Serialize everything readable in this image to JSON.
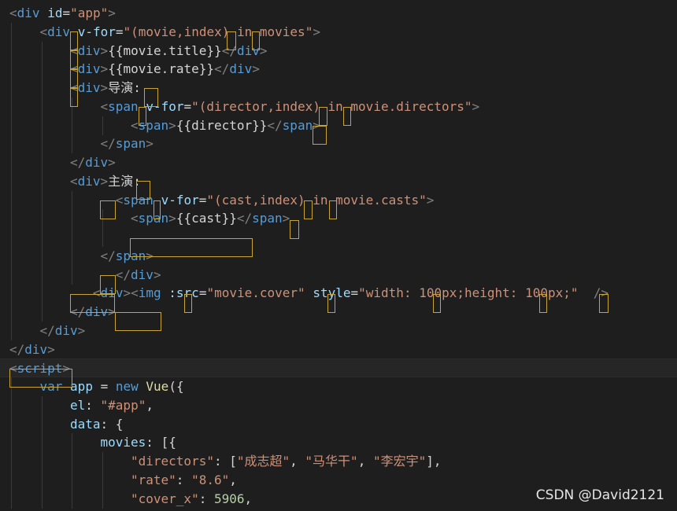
{
  "code_lines": [
    {
      "indent": 0,
      "tokens": [
        [
          "punct",
          "<"
        ],
        [
          "tag",
          "div"
        ],
        [
          "txt",
          " "
        ],
        [
          "attr",
          "id"
        ],
        [
          "txt",
          "="
        ],
        [
          "str",
          "\"app\""
        ],
        [
          "punct",
          ">"
        ]
      ]
    },
    {
      "indent": 1,
      "tokens": [
        [
          "punct",
          "<"
        ],
        [
          "tag",
          "div"
        ],
        [
          "txt",
          " "
        ],
        [
          "attr",
          "v-for"
        ],
        [
          "txt",
          "="
        ],
        [
          "str",
          "\"(movie,index) in movies\""
        ],
        [
          "punct",
          ">"
        ]
      ]
    },
    {
      "indent": 2,
      "tokens": [
        [
          "punct",
          "<"
        ],
        [
          "tag",
          "div"
        ],
        [
          "punct",
          ">"
        ],
        [
          "txt",
          "{{movie.title}}"
        ],
        [
          "punct",
          "</"
        ],
        [
          "tag",
          "div"
        ],
        [
          "punct",
          ">"
        ]
      ]
    },
    {
      "indent": 2,
      "tokens": [
        [
          "punct",
          "<"
        ],
        [
          "tag",
          "div"
        ],
        [
          "punct",
          ">"
        ],
        [
          "txt",
          "{{movie.rate}}"
        ],
        [
          "punct",
          "</"
        ],
        [
          "tag",
          "div"
        ],
        [
          "punct",
          ">"
        ]
      ]
    },
    {
      "indent": 2,
      "tokens": [
        [
          "punct",
          "<"
        ],
        [
          "tag",
          "div"
        ],
        [
          "punct",
          ">"
        ],
        [
          "txt",
          "导演:"
        ]
      ]
    },
    {
      "indent": 3,
      "tokens": [
        [
          "punct",
          "<"
        ],
        [
          "tag",
          "span"
        ],
        [
          "txt",
          " "
        ],
        [
          "attr",
          "v-for"
        ],
        [
          "txt",
          "="
        ],
        [
          "str",
          "\"(director,index) in movie.directors\""
        ],
        [
          "punct",
          ">"
        ]
      ]
    },
    {
      "indent": 4,
      "tokens": [
        [
          "punct",
          "<"
        ],
        [
          "tag",
          "span"
        ],
        [
          "punct",
          ">"
        ],
        [
          "txt",
          "{{director}}"
        ],
        [
          "punct",
          "</"
        ],
        [
          "tag",
          "span"
        ],
        [
          "punct",
          ">"
        ]
      ]
    },
    {
      "indent": 3,
      "tokens": [
        [
          "punct",
          "</"
        ],
        [
          "tag",
          "span"
        ],
        [
          "punct",
          ">"
        ]
      ]
    },
    {
      "indent": 2,
      "tokens": [
        [
          "punct",
          "</"
        ],
        [
          "tag",
          "div"
        ],
        [
          "punct",
          ">"
        ]
      ]
    },
    {
      "indent": 2,
      "tokens": [
        [
          "punct",
          "<"
        ],
        [
          "tag",
          "div"
        ],
        [
          "punct",
          ">"
        ],
        [
          "txt",
          "主演:"
        ]
      ]
    },
    {
      "indent": 3,
      "tokens": [
        [
          "txt",
          "  "
        ],
        [
          "punct",
          "<"
        ],
        [
          "tag",
          "span"
        ],
        [
          "txt",
          " "
        ],
        [
          "attr",
          "v-for"
        ],
        [
          "txt",
          "="
        ],
        [
          "str",
          "\"(cast,index) in movie.casts\""
        ],
        [
          "punct",
          ">"
        ]
      ]
    },
    {
      "indent": 4,
      "tokens": [
        [
          "punct",
          "<"
        ],
        [
          "tag",
          "span"
        ],
        [
          "punct",
          ">"
        ],
        [
          "txt",
          "{{cast}}"
        ],
        [
          "punct",
          "</"
        ],
        [
          "tag",
          "span"
        ],
        [
          "punct",
          ">"
        ]
      ]
    },
    {
      "indent": 4,
      "tokens": []
    },
    {
      "indent": 3,
      "tokens": [
        [
          "punct",
          "</"
        ],
        [
          "tag",
          "span"
        ],
        [
          "punct",
          ">"
        ]
      ]
    },
    {
      "indent": 3,
      "tokens": [
        [
          "txt",
          "  "
        ],
        [
          "punct",
          "</"
        ],
        [
          "tag",
          "div"
        ],
        [
          "punct",
          ">"
        ]
      ]
    },
    {
      "indent": 2,
      "tokens": [
        [
          "txt",
          "   "
        ],
        [
          "punct",
          "<"
        ],
        [
          "tag",
          "div"
        ],
        [
          "punct",
          ">"
        ],
        [
          "punct",
          "<"
        ],
        [
          "tag",
          "img"
        ],
        [
          "txt",
          " "
        ],
        [
          "attr",
          ":src"
        ],
        [
          "txt",
          "="
        ],
        [
          "str",
          "\"movie.cover\""
        ],
        [
          "txt",
          " "
        ],
        [
          "attr",
          "style"
        ],
        [
          "txt",
          "="
        ],
        [
          "str",
          "\"width: 100px;height: 100px;\""
        ],
        [
          "txt",
          "  "
        ],
        [
          "punct",
          "/>"
        ]
      ]
    },
    {
      "indent": 2,
      "tokens": [
        [
          "punct",
          "</"
        ],
        [
          "tag",
          "div"
        ],
        [
          "punct",
          ">"
        ]
      ]
    },
    {
      "indent": 1,
      "tokens": [
        [
          "punct",
          "</"
        ],
        [
          "tag",
          "div"
        ],
        [
          "punct",
          ">"
        ]
      ]
    },
    {
      "indent": 0,
      "tokens": [
        [
          "punct",
          "</"
        ],
        [
          "tag",
          "div"
        ],
        [
          "punct",
          ">"
        ]
      ]
    },
    {
      "indent": 0,
      "tokens": [
        [
          "punct",
          "<"
        ],
        [
          "tag",
          "script"
        ],
        [
          "punct",
          ">"
        ]
      ]
    },
    {
      "indent": 1,
      "tokens": [
        [
          "kw",
          "var"
        ],
        [
          "txt",
          " "
        ],
        [
          "attr",
          "app"
        ],
        [
          "txt",
          " = "
        ],
        [
          "kw",
          "new"
        ],
        [
          "txt",
          " "
        ],
        [
          "fn",
          "Vue"
        ],
        [
          "txt",
          "({"
        ]
      ]
    },
    {
      "indent": 2,
      "tokens": [
        [
          "attr",
          "el"
        ],
        [
          "txt",
          ": "
        ],
        [
          "str",
          "\"#app\""
        ],
        [
          "txt",
          ","
        ]
      ]
    },
    {
      "indent": 2,
      "tokens": [
        [
          "attr",
          "data"
        ],
        [
          "txt",
          ": {"
        ]
      ]
    },
    {
      "indent": 3,
      "tokens": [
        [
          "attr",
          "movies"
        ],
        [
          "txt",
          ": [{"
        ]
      ]
    },
    {
      "indent": 4,
      "tokens": [
        [
          "str",
          "\"directors\""
        ],
        [
          "txt",
          ": ["
        ],
        [
          "str",
          "\"成志超\""
        ],
        [
          "txt",
          ", "
        ],
        [
          "str",
          "\"马华干\""
        ],
        [
          "txt",
          ", "
        ],
        [
          "str",
          "\"李宏宇\""
        ],
        [
          "txt",
          "],"
        ]
      ]
    },
    {
      "indent": 4,
      "tokens": [
        [
          "str",
          "\"rate\""
        ],
        [
          "txt",
          ": "
        ],
        [
          "str",
          "\"8.6\""
        ],
        [
          "txt",
          ","
        ]
      ]
    },
    {
      "indent": 4,
      "tokens": [
        [
          "str",
          "\"cover_x\""
        ],
        [
          "txt",
          ": "
        ],
        [
          "num",
          "5906"
        ],
        [
          "txt",
          ","
        ]
      ]
    }
  ],
  "watermark": "CSDN @David2121",
  "colors": {
    "background": "#1e1e1e",
    "tag": "#569cd6",
    "attr": "#9cdcfe",
    "string": "#ce9178",
    "highlight_box": "#c8a433"
  }
}
